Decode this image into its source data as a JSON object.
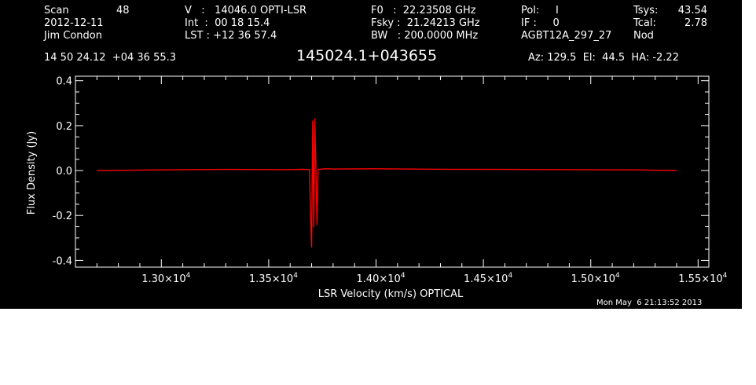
{
  "header": {
    "col1": {
      "scan_label": "Scan",
      "scan_value": "48",
      "date": "2012-12-11",
      "observer": "Jim Condon"
    },
    "col2": {
      "v_line": "V   :   14046.0 OPTI-LSR",
      "int_line": "Int  :  00 18 15.4",
      "lst_line": "LST : +12 36 57.4"
    },
    "col3": {
      "f0_line": "F0   :  22.23508 GHz",
      "fsky_line": "Fsky :  21.24213 GHz",
      "bw_line": "BW   : 200.0000 MHz"
    },
    "col4": {
      "pol_line": "Pol:     I",
      "if_line": "IF :     0",
      "proj_line": "AGBT12A_297_27"
    },
    "col5": {
      "tsys_label": "Tsys:",
      "tsys_value": "43.54",
      "tcal_label": "Tcal:",
      "tcal_value": "2.78",
      "nod": "Nod"
    },
    "coords": "14 50 24.12  +04 36 55.3",
    "source": "145024.1+043655",
    "pointing": "Az: 129.5  El:  44.5  HA: -2.22"
  },
  "footer": {
    "timestamp": "Mon May  6 21:13:52 2013"
  },
  "colors": {
    "background": "#000000",
    "axes": "#ffffff",
    "series": "#ff0000"
  },
  "chart_data": {
    "type": "line",
    "title": "145024.1+043655",
    "xlabel": "LSR Velocity (km/s) OPTICAL",
    "ylabel": "Flux Density (Jy)",
    "xlim": [
      12600,
      15550
    ],
    "ylim": [
      -0.43,
      0.42
    ],
    "x_ticks": [
      {
        "value": 13000,
        "mantissa": "1.30×10",
        "exp": "4"
      },
      {
        "value": 13500,
        "mantissa": "1.35×10",
        "exp": "4"
      },
      {
        "value": 14000,
        "mantissa": "1.40×10",
        "exp": "4"
      },
      {
        "value": 14500,
        "mantissa": "1.45×10",
        "exp": "4"
      },
      {
        "value": 15000,
        "mantissa": "1.50×10",
        "exp": "4"
      },
      {
        "value": 15500,
        "mantissa": "1.55×10",
        "exp": "4"
      }
    ],
    "y_ticks": [
      {
        "value": 0.4,
        "label": "0.4"
      },
      {
        "value": 0.2,
        "label": "0.2"
      },
      {
        "value": 0.0,
        "label": "0.0"
      },
      {
        "value": -0.2,
        "label": "-0.2"
      },
      {
        "value": -0.4,
        "label": "-0.4"
      }
    ],
    "grid": false,
    "series": [
      {
        "color": "#ff0000",
        "x": [
          12700,
          13000,
          13300,
          13600,
          13660,
          13680,
          13690,
          13695,
          13700,
          13705,
          13710,
          13715,
          13720,
          13725,
          13730,
          13740,
          13760,
          13800,
          14000,
          14300,
          14600,
          14900,
          15200,
          15400
        ],
        "y": [
          0.0,
          0.003,
          0.005,
          0.004,
          0.006,
          0.004,
          0.005,
          -0.2,
          -0.34,
          0.22,
          -0.25,
          0.23,
          0.0,
          -0.24,
          0.005,
          0.006,
          0.008,
          0.007,
          0.008,
          0.006,
          0.005,
          0.004,
          0.003,
          0.0
        ]
      }
    ]
  }
}
